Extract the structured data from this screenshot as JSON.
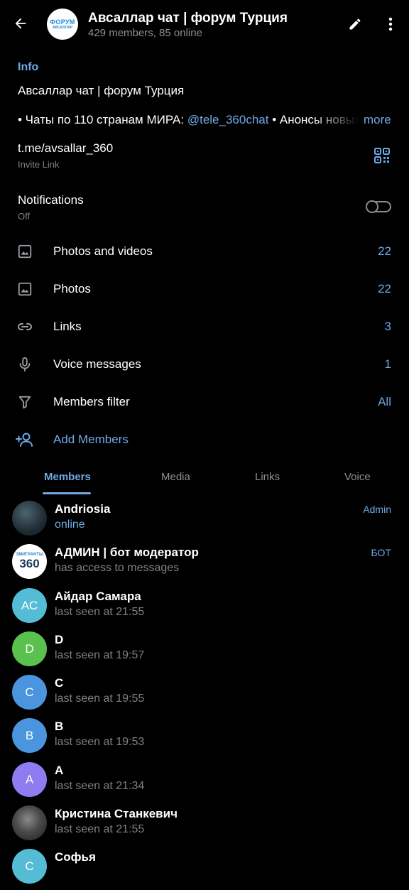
{
  "header": {
    "title": "Авсаллар чат | форум Турция",
    "subtitle": "429 members, 85 online",
    "logo_top": "ФОРУМ",
    "logo_bottom": "АВСАЛЛАР",
    "back_icon": "arrow-left-icon",
    "edit_icon": "pencil-icon",
    "more_icon": "vertical-dots-icon"
  },
  "info": {
    "section_label": "Info",
    "title": "Авсаллар чат | форум Турция",
    "description_prefix": "• Чаты по 110 странам МИРА: ",
    "description_mention": "@tele_360chat",
    "description_suffix": " • Анонсы новых",
    "more_label": "more",
    "invite_link": "t.me/avsallar_360",
    "invite_sub": "Invite Link",
    "notifications_label": "Notifications",
    "notifications_value": "Off"
  },
  "shared_rows": [
    {
      "icon": "image-icon",
      "label": "Photos and videos",
      "value": "22"
    },
    {
      "icon": "image-icon",
      "label": "Photos",
      "value": "22"
    },
    {
      "icon": "link-icon",
      "label": "Links",
      "value": "3"
    },
    {
      "icon": "microphone-icon",
      "label": "Voice messages",
      "value": "1"
    },
    {
      "icon": "filter-icon",
      "label": "Members filter",
      "value": "All"
    },
    {
      "icon": "add-user-icon",
      "label": "Add Members",
      "value": ""
    }
  ],
  "tabs": [
    "Members",
    "Media",
    "Links",
    "Voice"
  ],
  "members": [
    {
      "name": "Andriosia",
      "status": "online",
      "role": "Admin",
      "initials": "",
      "color": "#2b3b45"
    },
    {
      "name": "АДМИН | бот модератор",
      "status": "has access to messages",
      "role": "БОТ",
      "initials": "",
      "color": "#ffffff",
      "logo_text": "ЭМИГРАНТЫ",
      "logo_num": "360"
    },
    {
      "name": "Айдар Самара",
      "status": "last seen at 21:55",
      "role": "",
      "initials": "АС",
      "color": "#55bcd6"
    },
    {
      "name": "D",
      "status": "last seen at 19:57",
      "role": "",
      "initials": "D",
      "color": "#5ac14f"
    },
    {
      "name": "C",
      "status": "last seen at 19:55",
      "role": "",
      "initials": "C",
      "color": "#4a95dd"
    },
    {
      "name": "B",
      "status": "last seen at 19:53",
      "role": "",
      "initials": "B",
      "color": "#4a95dd"
    },
    {
      "name": "A",
      "status": "last seen at 21:34",
      "role": "",
      "initials": "A",
      "color": "#8f7cf0"
    },
    {
      "name": "Кристина Станкевич",
      "status": "last seen at 21:55",
      "role": "",
      "initials": "",
      "color": "#3a3a3a"
    },
    {
      "name": "Софья",
      "status": "",
      "role": "",
      "initials": "С",
      "color": "#55bcd6"
    }
  ],
  "colors": {
    "accent": "#6fa9e6",
    "background": "#000000",
    "muted": "#7d8187"
  }
}
